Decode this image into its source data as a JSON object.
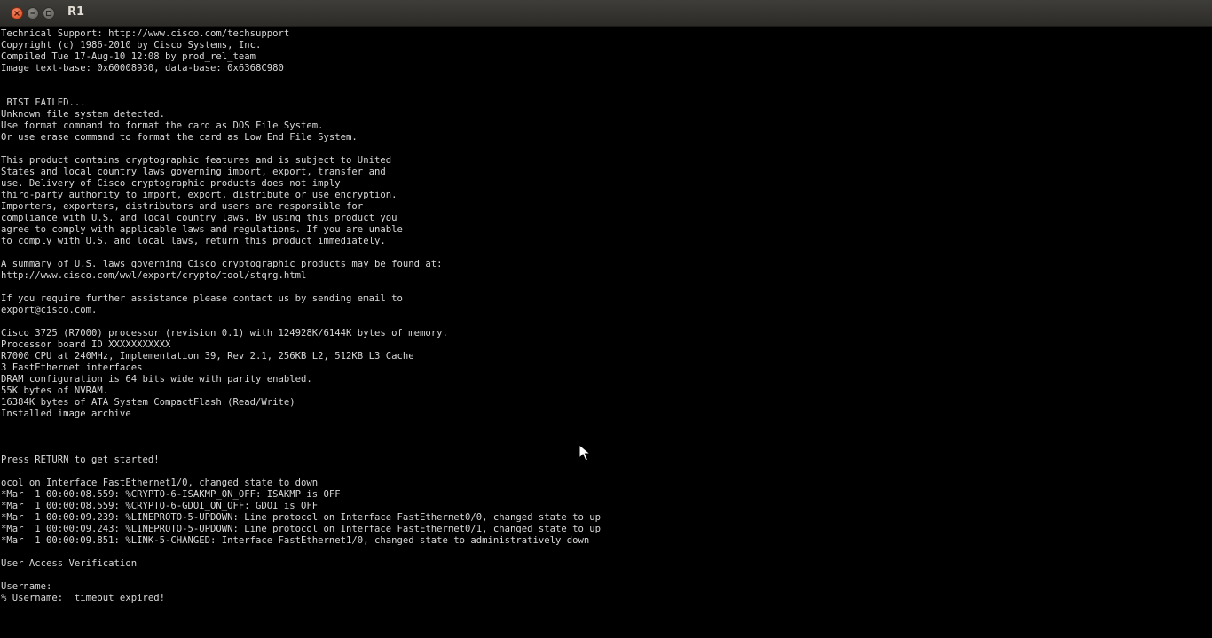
{
  "window": {
    "title": "R1"
  },
  "terminal": {
    "lines": [
      "Technical Support: http://www.cisco.com/techsupport",
      "Copyright (c) 1986-2010 by Cisco Systems, Inc.",
      "Compiled Tue 17-Aug-10 12:08 by prod_rel_team",
      "Image text-base: 0x60008930, data-base: 0x6368C980",
      "",
      "",
      " BIST FAILED...",
      "Unknown file system detected.",
      "Use format command to format the card as DOS File System.",
      "Or use erase command to format the card as Low End File System.",
      "",
      "This product contains cryptographic features and is subject to United",
      "States and local country laws governing import, export, transfer and",
      "use. Delivery of Cisco cryptographic products does not imply",
      "third-party authority to import, export, distribute or use encryption.",
      "Importers, exporters, distributors and users are responsible for",
      "compliance with U.S. and local country laws. By using this product you",
      "agree to comply with applicable laws and regulations. If you are unable",
      "to comply with U.S. and local laws, return this product immediately.",
      "",
      "A summary of U.S. laws governing Cisco cryptographic products may be found at:",
      "http://www.cisco.com/wwl/export/crypto/tool/stqrg.html",
      "",
      "If you require further assistance please contact us by sending email to",
      "export@cisco.com.",
      "",
      "Cisco 3725 (R7000) processor (revision 0.1) with 124928K/6144K bytes of memory.",
      "Processor board ID XXXXXXXXXXX",
      "R7000 CPU at 240MHz, Implementation 39, Rev 2.1, 256KB L2, 512KB L3 Cache",
      "3 FastEthernet interfaces",
      "DRAM configuration is 64 bits wide with parity enabled.",
      "55K bytes of NVRAM.",
      "16384K bytes of ATA System CompactFlash (Read/Write)",
      "Installed image archive",
      "",
      "",
      "",
      "Press RETURN to get started!",
      "",
      "ocol on Interface FastEthernet1/0, changed state to down",
      "*Mar  1 00:00:08.559: %CRYPTO-6-ISAKMP_ON_OFF: ISAKMP is OFF",
      "*Mar  1 00:00:08.559: %CRYPTO-6-GDOI_ON_OFF: GDOI is OFF",
      "*Mar  1 00:00:09.239: %LINEPROTO-5-UPDOWN: Line protocol on Interface FastEthernet0/0, changed state to up",
      "*Mar  1 00:00:09.243: %LINEPROTO-5-UPDOWN: Line protocol on Interface FastEthernet0/1, changed state to up",
      "*Mar  1 00:00:09.851: %LINK-5-CHANGED: Interface FastEthernet1/0, changed state to administratively down",
      "",
      "User Access Verification",
      "",
      "Username:",
      "% Username:  timeout expired!"
    ]
  }
}
